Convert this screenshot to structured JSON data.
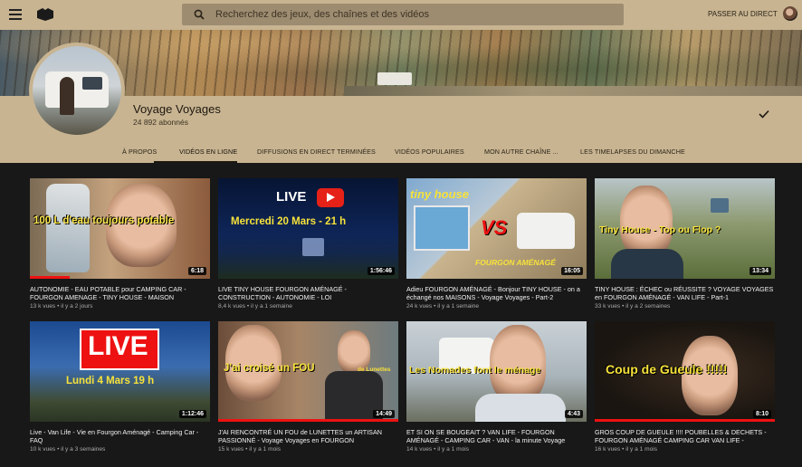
{
  "header": {
    "search_placeholder": "Recherchez des jeux, des chaînes et des vidéos",
    "live_button": "PASSER AU DIRECT"
  },
  "channel": {
    "name": "Voyage Voyages",
    "subscribers": "24 892 abonnés"
  },
  "tabs": [
    {
      "label": "À PROPOS"
    },
    {
      "label": "VIDÉOS EN LIGNE",
      "active": true
    },
    {
      "label": "DIFFUSIONS EN DIRECT TERMINÉES"
    },
    {
      "label": "VIDÉOS POPULAIRES"
    },
    {
      "label": "MON AUTRE CHAÎNE ..."
    },
    {
      "label": "LES TIMELAPSES DU DIMANCHE"
    }
  ],
  "videos": [
    {
      "title": "AUTONOMIE - EAU POTABLE pour CAMPING CAR - FOURGON AMENAGE - TINY HOUSE - MAISON",
      "views": "13 k vues",
      "age": "il y a 2 jours",
      "duration": "6:18",
      "overlay": "100 L d'eau toujours potable",
      "progress": 0.22
    },
    {
      "title": "LIVE TINY HOUSE FOURGON AMÉNAGÉ - CONSTRUCTION - AUTONOMIE - LOI",
      "views": "8,4 k vues",
      "age": "il y a 1 semaine",
      "duration": "1:56:46",
      "overlay": "LIVE",
      "overlay2": "Mercredi 20 Mars - 21 h"
    },
    {
      "title": "Adieu FOURGON AMÉNAGÉ - Bonjour TINY HOUSE - on a échangé nos MAISONS - Voyage Voyages - Part-2",
      "views": "24 k vues",
      "age": "il y a 1 semaine",
      "duration": "16:05",
      "overlay": "tiny house",
      "overlay2": "VS",
      "overlay3": "FOURGON AMÉNAGÉ"
    },
    {
      "title": "TINY HOUSE : ÉCHEC ou RÉUSSITE ? VOYAGE VOYAGES en FOURGON AMÉNAGÉ - VAN LIFE - Part-1",
      "views": "33 k vues",
      "age": "il y a 2 semaines",
      "duration": "13:34",
      "overlay": "Tiny House - Top ou Flop ?"
    },
    {
      "title": "Live - Van Life - Vie en Fourgon Aménagé - Camping Car - FAQ",
      "views": "10 k vues",
      "age": "il y a 3 semaines",
      "duration": "1:12:46",
      "overlay": "LIVE",
      "overlay2": "Lundi 4 Mars 19 h"
    },
    {
      "title": "J'AI RENCONTRÉ UN FOU de LUNETTES un ARTISAN PASSIONNÉ - Voyage Voyages en FOURGON",
      "views": "15 k vues",
      "age": "il y a 1 mois",
      "duration": "14:49",
      "overlay": "J'ai croisé un FOU",
      "overlay2": "de Lunettes",
      "progress": 1.0
    },
    {
      "title": "ET SI ON SE BOUGEAIT ? VAN LIFE - FOURGON AMÉNAGÉ - CAMPING CAR - VAN - la minute Voyage",
      "views": "14 k vues",
      "age": "il y a 1 mois",
      "duration": "4:43",
      "overlay": "Les Nomades font le ménage"
    },
    {
      "title": "GROS COUP DE GUEULE !!!! POUBELLES & DECHETS - FOURGON AMÉNAGÉ CAMPING CAR VAN LIFE -",
      "views": "16 k vues",
      "age": "il y a 1 mois",
      "duration": "8:10",
      "overlay": "Coup de Gueule !!!!!",
      "progress": 1.0
    }
  ],
  "colors": {
    "header_bg": "#c8b491",
    "page_bg": "#181818",
    "accent_red": "#ee1111"
  },
  "icons": [
    "menu-icon",
    "logo-icon",
    "search-icon",
    "caret-down-icon",
    "check-icon",
    "user-avatar"
  ]
}
